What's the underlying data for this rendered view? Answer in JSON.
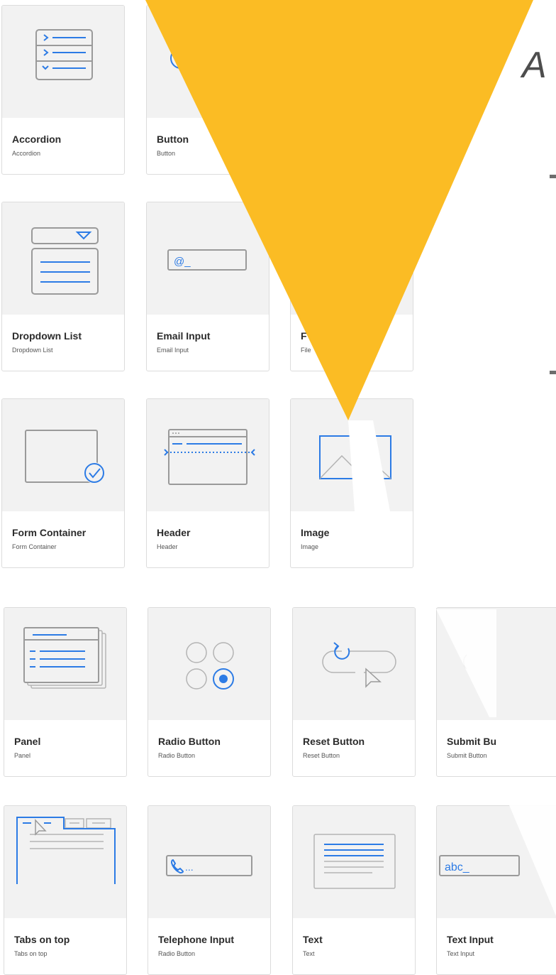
{
  "page": {
    "heading_fragment": "A",
    "accent_color": "#fbbc24",
    "icon_blue": "#2c7be5",
    "icon_gray": "#9a9a9a"
  },
  "cards": [
    {
      "title": "Accordion",
      "subtitle": "Accordion",
      "icon": "accordion-icon"
    },
    {
      "title": "Button",
      "subtitle": "Button",
      "icon": "button-icon"
    },
    {
      "title": "Dropdown List",
      "subtitle": "Dropdown List",
      "icon": "dropdown-list-icon"
    },
    {
      "title": "Email Input",
      "subtitle": "Email Input",
      "icon": "email-input-icon"
    },
    {
      "title": "F",
      "subtitle": "File",
      "icon": "file-input-icon"
    },
    {
      "title": "Form Container",
      "subtitle": "Form Container",
      "icon": "form-container-icon"
    },
    {
      "title": "Header",
      "subtitle": "Header",
      "icon": "header-icon"
    },
    {
      "title": "Image",
      "subtitle": "Image",
      "icon": "image-icon"
    },
    {
      "title": "Panel",
      "subtitle": "Panel",
      "icon": "panel-icon"
    },
    {
      "title": "Radio Button",
      "subtitle": "Radio Button",
      "icon": "radio-button-icon"
    },
    {
      "title": "Reset Button",
      "subtitle": "Reset Button",
      "icon": "reset-button-icon"
    },
    {
      "title": "Submit Bu",
      "subtitle": "Submit Button",
      "icon": "submit-button-icon"
    },
    {
      "title": "Tabs on top",
      "subtitle": "Tabs on top",
      "icon": "tabs-on-top-icon"
    },
    {
      "title": "Telephone Input",
      "subtitle": "Radio Button",
      "icon": "telephone-input-icon",
      "icon_text": "..."
    },
    {
      "title": "Text",
      "subtitle": "Text",
      "icon": "text-icon"
    },
    {
      "title": "Text Input",
      "subtitle": "Text Input",
      "icon": "text-input-icon",
      "icon_text": "abc_"
    }
  ]
}
